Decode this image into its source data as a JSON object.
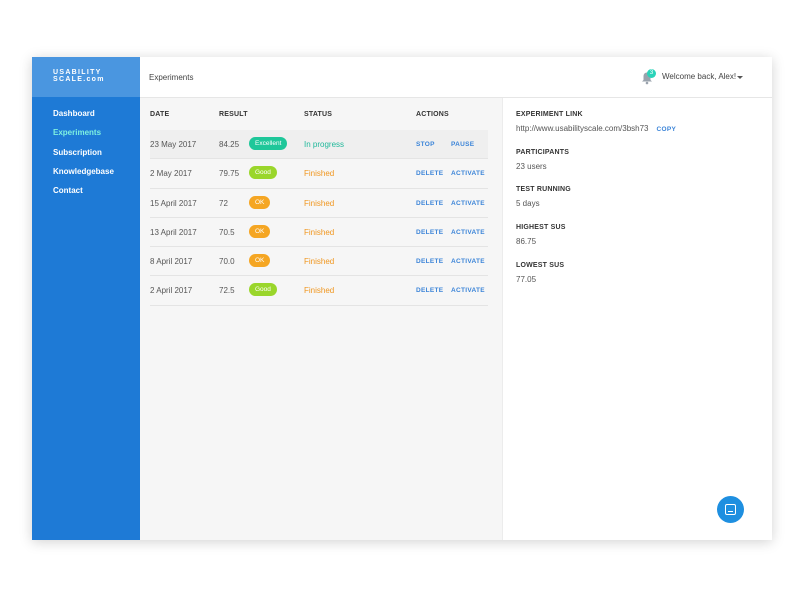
{
  "logo": {
    "line1": "USABILITY",
    "line2": "SCALE.com"
  },
  "sidebar": {
    "items": [
      {
        "label": "Dashboard"
      },
      {
        "label": "Experiments",
        "active": true
      },
      {
        "label": "Subscription"
      },
      {
        "label": "Knowledgebase"
      },
      {
        "label": "Contact"
      }
    ]
  },
  "header": {
    "title": "Experiments",
    "notification_count": "3",
    "welcome": "Welcome back, Alex!"
  },
  "table": {
    "columns": [
      "DATE",
      "RESULT",
      "STATUS",
      "ACTIONS"
    ],
    "rows": [
      {
        "date": "23 May 2017",
        "score": "84.25",
        "grade": "Excellent",
        "status": "In progress",
        "action1": "STOP",
        "action2": "PAUSE"
      },
      {
        "date": "2 May 2017",
        "score": "79.75",
        "grade": "Good",
        "status": "Finished",
        "action1": "DELETE",
        "action2": "ACTIVATE"
      },
      {
        "date": "15 April 2017",
        "score": "72",
        "grade": "OK",
        "status": "Finished",
        "action1": "DELETE",
        "action2": "ACTIVATE"
      },
      {
        "date": "13 April 2017",
        "score": "70.5",
        "grade": "OK",
        "status": "Finished",
        "action1": "DELETE",
        "action2": "ACTIVATE"
      },
      {
        "date": "8 April 2017",
        "score": "70.0",
        "grade": "OK",
        "status": "Finished",
        "action1": "DELETE",
        "action2": "ACTIVATE"
      },
      {
        "date": "2 April 2017",
        "score": "72.5",
        "grade": "Good",
        "status": "Finished",
        "action1": "DELETE",
        "action2": "ACTIVATE"
      }
    ]
  },
  "colors": {
    "excellent": "#1fc79a",
    "good": "#9ad62b",
    "ok": "#f5a623",
    "in_progress": "#1fb89a",
    "finished": "#f0961e",
    "sidebar": "#1e7ad6"
  },
  "details": {
    "link_label": "EXPERIMENT LINK",
    "link_value": "http://www.usabilityscale.com/3bsh73",
    "copy_label": "COPY",
    "participants_label": "PARTICIPANTS",
    "participants_value": "23 users",
    "running_label": "TEST RUNNING",
    "running_value": "5 days",
    "highest_label": "HIGHEST SUS",
    "highest_value": "86.75",
    "lowest_label": "LOWEST SUS",
    "lowest_value": "77.05"
  },
  "icons": {
    "bell": "bell-icon",
    "caret": "chevron-down-icon",
    "chat": "chat-icon"
  }
}
